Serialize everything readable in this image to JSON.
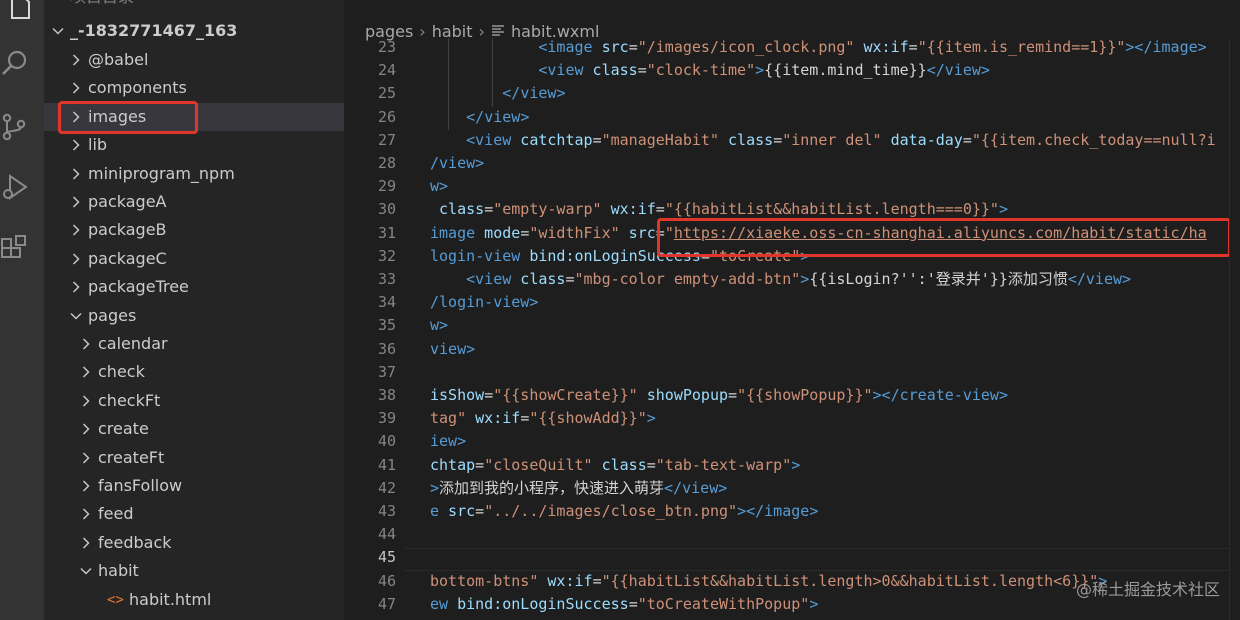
{
  "sidebar": {
    "top_cut_label": "项目目录",
    "root_label": "_-1832771467_163",
    "items": [
      {
        "label": "@babel",
        "type": "folder",
        "depth": 1,
        "expanded": false
      },
      {
        "label": "components",
        "type": "folder",
        "depth": 1,
        "expanded": false
      },
      {
        "label": "images",
        "type": "folder",
        "depth": 1,
        "expanded": false,
        "selected": true,
        "highlighted": true
      },
      {
        "label": "lib",
        "type": "folder",
        "depth": 1,
        "expanded": false
      },
      {
        "label": "miniprogram_npm",
        "type": "folder",
        "depth": 1,
        "expanded": false
      },
      {
        "label": "packageA",
        "type": "folder",
        "depth": 1,
        "expanded": false
      },
      {
        "label": "packageB",
        "type": "folder",
        "depth": 1,
        "expanded": false
      },
      {
        "label": "packageC",
        "type": "folder",
        "depth": 1,
        "expanded": false
      },
      {
        "label": "packageTree",
        "type": "folder",
        "depth": 1,
        "expanded": false
      },
      {
        "label": "pages",
        "type": "folder",
        "depth": 1,
        "expanded": true
      },
      {
        "label": "calendar",
        "type": "folder",
        "depth": 2,
        "expanded": false
      },
      {
        "label": "check",
        "type": "folder",
        "depth": 2,
        "expanded": false
      },
      {
        "label": "checkFt",
        "type": "folder",
        "depth": 2,
        "expanded": false
      },
      {
        "label": "create",
        "type": "folder",
        "depth": 2,
        "expanded": false
      },
      {
        "label": "createFt",
        "type": "folder",
        "depth": 2,
        "expanded": false
      },
      {
        "label": "fansFollow",
        "type": "folder",
        "depth": 2,
        "expanded": false
      },
      {
        "label": "feed",
        "type": "folder",
        "depth": 2,
        "expanded": false
      },
      {
        "label": "feedback",
        "type": "folder",
        "depth": 2,
        "expanded": false
      },
      {
        "label": "habit",
        "type": "folder",
        "depth": 2,
        "expanded": true
      },
      {
        "label": "habit.html",
        "type": "file",
        "depth": 3,
        "file_icon": "<>"
      }
    ]
  },
  "breadcrumb": {
    "parts": [
      "pages",
      "habit",
      "habit.wxml"
    ]
  },
  "editor": {
    "line_numbers": [
      "23",
      "24",
      "25",
      "26",
      "27",
      "28",
      "29",
      "30",
      "31",
      "32",
      "33",
      "34",
      "35",
      "36",
      "37",
      "38",
      "39",
      "40",
      "41",
      "42",
      "43",
      "44",
      "45",
      "46",
      "47"
    ],
    "current_line": "45",
    "lines": [
      [
        {
          "t": "            <",
          "c": "tag"
        },
        {
          "t": "image",
          "c": "tag"
        },
        {
          "t": " src",
          "c": "attr"
        },
        {
          "t": "=",
          "c": "txt"
        },
        {
          "t": "\"/images/icon_clock.png\"",
          "c": "str"
        },
        {
          "t": " wx:if",
          "c": "attr"
        },
        {
          "t": "=",
          "c": "txt"
        },
        {
          "t": "\"{{item.is_remind==1}}\"",
          "c": "str"
        },
        {
          "t": "></",
          "c": "tag"
        },
        {
          "t": "image",
          "c": "tag"
        },
        {
          "t": ">",
          "c": "tag"
        }
      ],
      [
        {
          "t": "            <",
          "c": "tag"
        },
        {
          "t": "view",
          "c": "tag"
        },
        {
          "t": " class",
          "c": "attr"
        },
        {
          "t": "=",
          "c": "txt"
        },
        {
          "t": "\"clock-time\"",
          "c": "str"
        },
        {
          "t": ">",
          "c": "tag"
        },
        {
          "t": "{{item.mind_time}}",
          "c": "txt"
        },
        {
          "t": "</",
          "c": "tag"
        },
        {
          "t": "view",
          "c": "tag"
        },
        {
          "t": ">",
          "c": "tag"
        }
      ],
      [
        {
          "t": "        </",
          "c": "tag"
        },
        {
          "t": "view",
          "c": "tag"
        },
        {
          "t": ">",
          "c": "tag"
        }
      ],
      [
        {
          "t": "    </",
          "c": "tag"
        },
        {
          "t": "view",
          "c": "tag"
        },
        {
          "t": ">",
          "c": "tag"
        }
      ],
      [
        {
          "t": "    <",
          "c": "tag"
        },
        {
          "t": "view",
          "c": "tag"
        },
        {
          "t": " catchtap",
          "c": "attr"
        },
        {
          "t": "=",
          "c": "txt"
        },
        {
          "t": "\"manageHabit\"",
          "c": "str"
        },
        {
          "t": " class",
          "c": "attr"
        },
        {
          "t": "=",
          "c": "txt"
        },
        {
          "t": "\"inner del\"",
          "c": "str"
        },
        {
          "t": " data-day",
          "c": "attr"
        },
        {
          "t": "=",
          "c": "txt"
        },
        {
          "t": "\"{{item.check_today==null?i",
          "c": "str"
        }
      ],
      [
        {
          "t": "/",
          "c": "tag"
        },
        {
          "t": "view",
          "c": "tag"
        },
        {
          "t": ">",
          "c": "tag"
        }
      ],
      [
        {
          "t": "w>",
          "c": "tag"
        }
      ],
      [
        {
          "t": " class",
          "c": "attr"
        },
        {
          "t": "=",
          "c": "txt"
        },
        {
          "t": "\"empty-warp\"",
          "c": "str"
        },
        {
          "t": " wx:if",
          "c": "attr"
        },
        {
          "t": "=",
          "c": "txt"
        },
        {
          "t": "\"{{habitList&&habitList.length===0}}\"",
          "c": "str"
        },
        {
          "t": ">",
          "c": "tag"
        }
      ],
      [
        {
          "t": "image",
          "c": "tag"
        },
        {
          "t": " mode",
          "c": "attr"
        },
        {
          "t": "=",
          "c": "txt"
        },
        {
          "t": "\"widthFix\"",
          "c": "str"
        },
        {
          "t": " src",
          "c": "attr"
        },
        {
          "t": "=",
          "c": "txt"
        },
        {
          "t": "\"",
          "c": "str"
        },
        {
          "t": "https://xiaeke.oss-cn-shanghai.aliyuncs.com/habit/static/ha",
          "c": "url"
        }
      ],
      [
        {
          "t": "login-view",
          "c": "tag"
        },
        {
          "t": " bind:onLoginSuccess",
          "c": "attr"
        },
        {
          "t": "=",
          "c": "txt"
        },
        {
          "t": "\"toCreate\"",
          "c": "str"
        },
        {
          "t": ">",
          "c": "tag"
        }
      ],
      [
        {
          "t": "    <",
          "c": "tag"
        },
        {
          "t": "view",
          "c": "tag"
        },
        {
          "t": " class",
          "c": "attr"
        },
        {
          "t": "=",
          "c": "txt"
        },
        {
          "t": "\"mbg-color empty-add-btn\"",
          "c": "str"
        },
        {
          "t": ">",
          "c": "tag"
        },
        {
          "t": "{{isLogin?'':'登录并'}}添加习惯",
          "c": "txt"
        },
        {
          "t": "</",
          "c": "tag"
        },
        {
          "t": "view",
          "c": "tag"
        },
        {
          "t": ">",
          "c": "tag"
        }
      ],
      [
        {
          "t": "/",
          "c": "tag"
        },
        {
          "t": "login-view",
          "c": "tag"
        },
        {
          "t": ">",
          "c": "tag"
        }
      ],
      [
        {
          "t": "w>",
          "c": "tag"
        }
      ],
      [
        {
          "t": "view>",
          "c": "tag"
        }
      ],
      [
        {
          "t": "",
          "c": "txt"
        }
      ],
      [
        {
          "t": "isShow",
          "c": "attr"
        },
        {
          "t": "=",
          "c": "txt"
        },
        {
          "t": "\"{{showCreate}}\"",
          "c": "str"
        },
        {
          "t": " showPopup",
          "c": "attr"
        },
        {
          "t": "=",
          "c": "txt"
        },
        {
          "t": "\"{{showPopup}}\"",
          "c": "str"
        },
        {
          "t": "></",
          "c": "tag"
        },
        {
          "t": "create-view",
          "c": "tag"
        },
        {
          "t": ">",
          "c": "tag"
        }
      ],
      [
        {
          "t": "tag\"",
          "c": "str"
        },
        {
          "t": " wx:if",
          "c": "attr"
        },
        {
          "t": "=",
          "c": "txt"
        },
        {
          "t": "\"{{showAdd}}\"",
          "c": "str"
        },
        {
          "t": ">",
          "c": "tag"
        }
      ],
      [
        {
          "t": "iew>",
          "c": "tag"
        }
      ],
      [
        {
          "t": "chtap",
          "c": "attr"
        },
        {
          "t": "=",
          "c": "txt"
        },
        {
          "t": "\"closeQuilt\"",
          "c": "str"
        },
        {
          "t": " class",
          "c": "attr"
        },
        {
          "t": "=",
          "c": "txt"
        },
        {
          "t": "\"tab-text-warp\"",
          "c": "str"
        },
        {
          "t": ">",
          "c": "tag"
        }
      ],
      [
        {
          "t": ">",
          "c": "tag"
        },
        {
          "t": "添加到我的小程序，快速进入萌芽",
          "c": "txt"
        },
        {
          "t": "</",
          "c": "tag"
        },
        {
          "t": "view",
          "c": "tag"
        },
        {
          "t": ">",
          "c": "tag"
        }
      ],
      [
        {
          "t": "e",
          "c": "tag"
        },
        {
          "t": " src",
          "c": "attr"
        },
        {
          "t": "=",
          "c": "txt"
        },
        {
          "t": "\"../../images/close_btn.png\"",
          "c": "str"
        },
        {
          "t": "></",
          "c": "tag"
        },
        {
          "t": "image",
          "c": "tag"
        },
        {
          "t": ">",
          "c": "tag"
        }
      ],
      [
        {
          "t": "",
          "c": "txt"
        }
      ],
      [
        {
          "t": "",
          "c": "txt"
        }
      ],
      [
        {
          "t": "bottom-btns\"",
          "c": "str"
        },
        {
          "t": " wx:if",
          "c": "attr"
        },
        {
          "t": "=",
          "c": "txt"
        },
        {
          "t": "\"{{habitList&&habitList.length>0&&habitList.length<6}}\"",
          "c": "str"
        },
        {
          "t": ">",
          "c": "tag"
        }
      ],
      [
        {
          "t": "ew",
          "c": "tag"
        },
        {
          "t": " bind:onLoginSuccess",
          "c": "attr"
        },
        {
          "t": "=",
          "c": "txt"
        },
        {
          "t": "\"toCreateWithPopup\"",
          "c": "str"
        },
        {
          "t": ">",
          "c": "tag"
        }
      ]
    ]
  },
  "watermark": "@稀土掘金技术社区",
  "colors": {
    "highlight_box": "#e0352b",
    "tag": "#569cd6",
    "attr": "#9cdcfe",
    "string": "#ce9178"
  },
  "icons": [
    "explorer-icon",
    "search-icon",
    "source-control-icon",
    "run-debug-icon",
    "extensions-icon",
    "chevron-right-icon",
    "chevron-down-icon",
    "file-code-icon",
    "lines-file-icon"
  ]
}
